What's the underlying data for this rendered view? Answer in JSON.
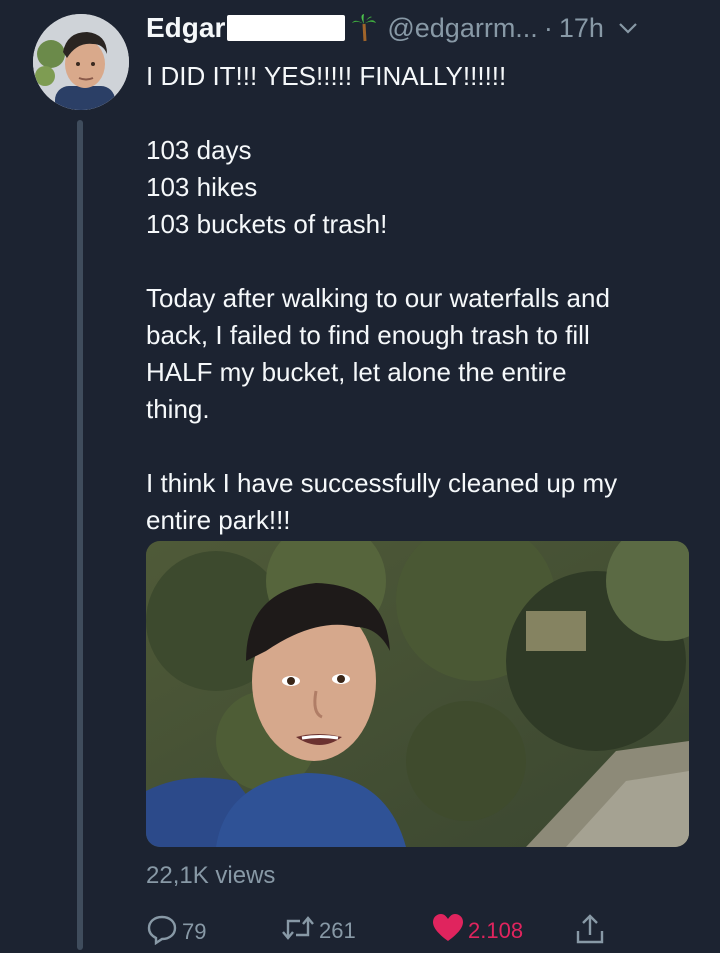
{
  "tweet": {
    "display_name": "Edgar",
    "handle": "@edgarrm...",
    "separator": "·",
    "time": "17h",
    "text_lines": [
      "I DID IT!!! YES!!!!! FINALLY!!!!!!",
      "",
      "103 days",
      "103 hikes",
      "103 buckets of trash!",
      "",
      "Today after walking to our waterfalls and",
      "back, I failed to find enough trash to fill",
      "HALF my bucket, let alone the entire",
      "thing.",
      "",
      "I think I have successfully cleaned up my",
      "entire park!!!"
    ],
    "views": "22,1K views",
    "replies": "79",
    "retweets": "261",
    "likes": "2.108"
  },
  "icons": {
    "palm": "palm-tree-icon",
    "chevron": "chevron-down-icon",
    "reply": "reply-icon",
    "retweet": "retweet-icon",
    "like": "heart-icon",
    "share": "share-icon"
  },
  "colors": {
    "background": "#1c2331",
    "text": "#f5f8fa",
    "secondary": "#8899a6",
    "like": "#e0245e",
    "thread_line": "#3f4c5c"
  }
}
